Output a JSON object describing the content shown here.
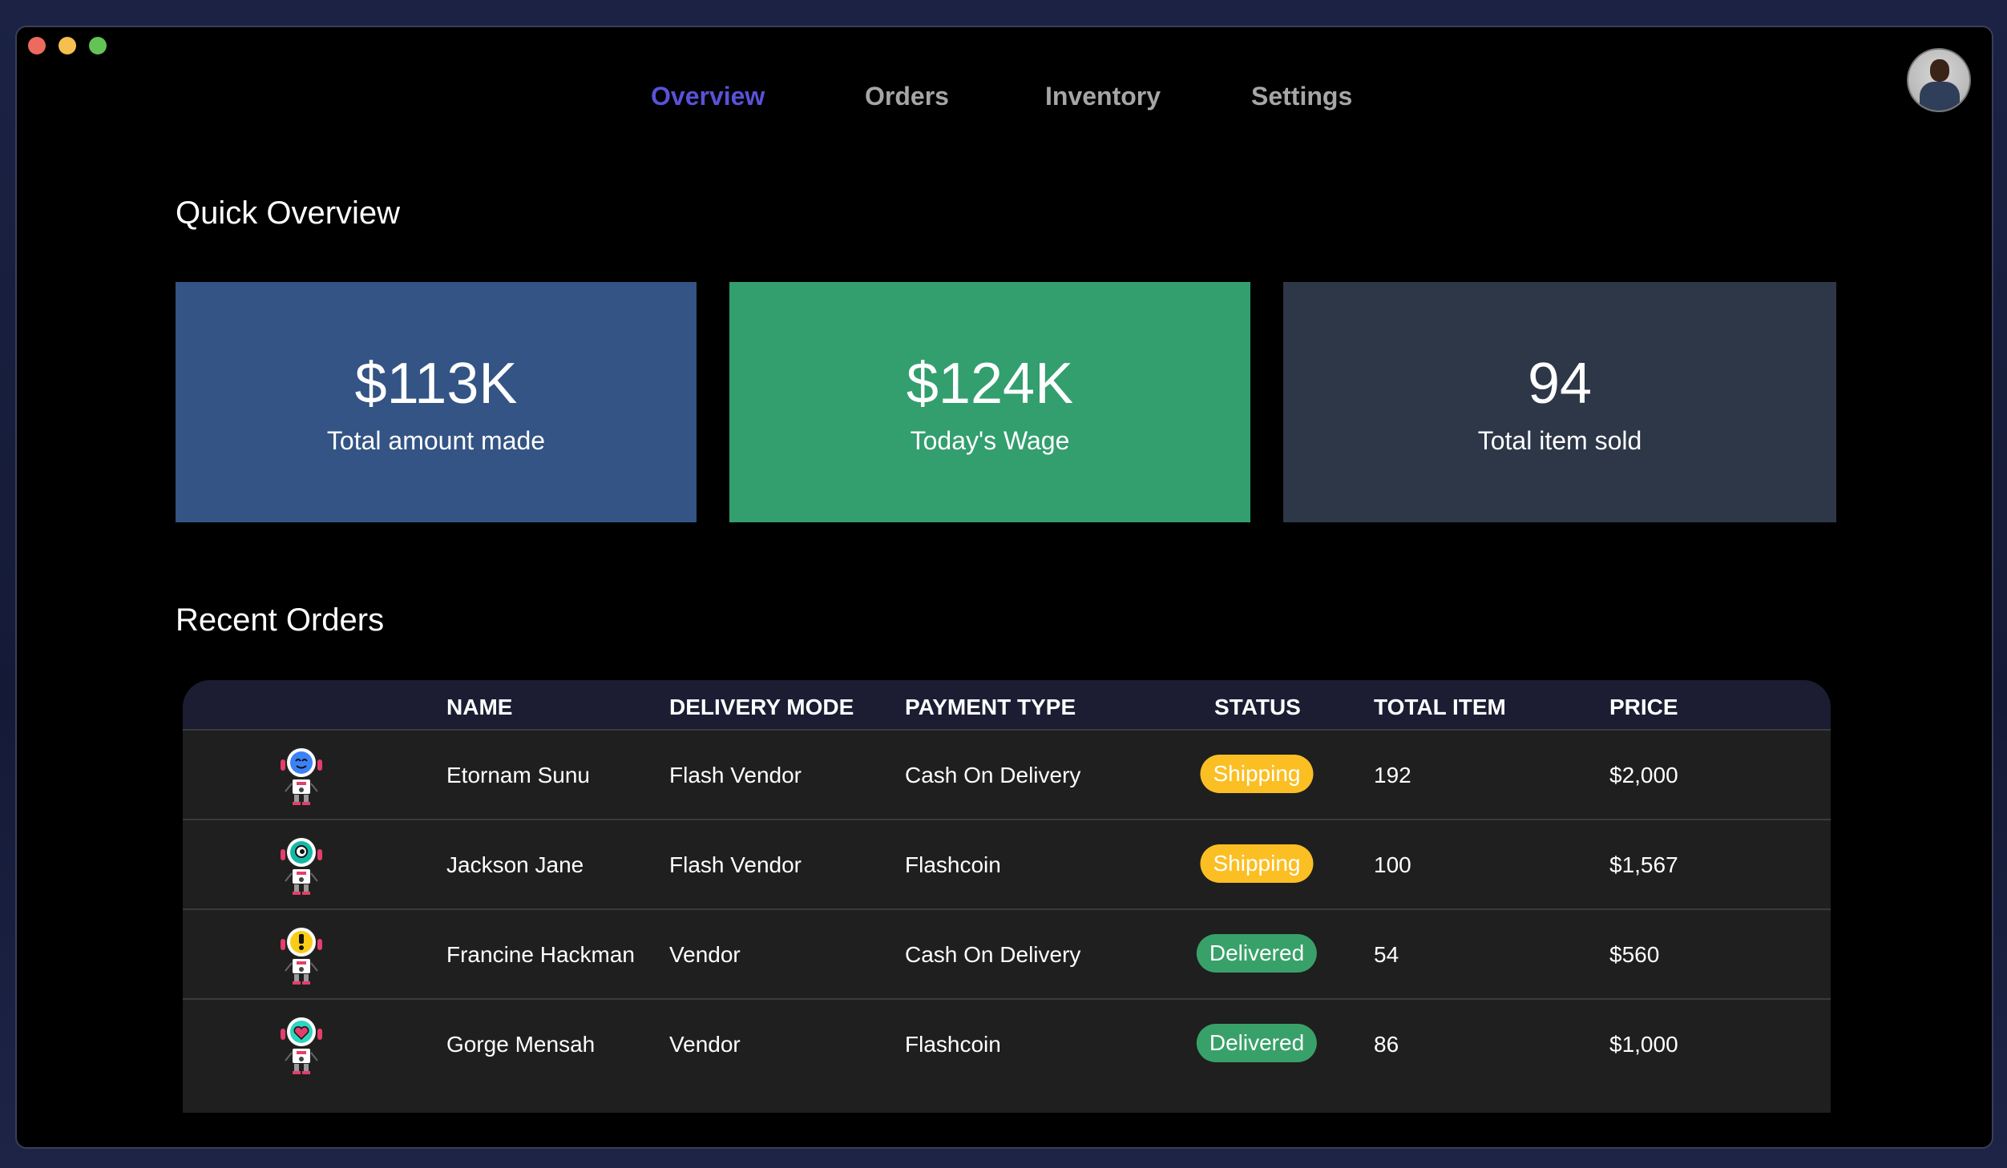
{
  "nav": {
    "items": [
      {
        "label": "Overview",
        "active": true
      },
      {
        "label": "Orders",
        "active": false
      },
      {
        "label": "Inventory",
        "active": false
      },
      {
        "label": "Settings",
        "active": false
      }
    ]
  },
  "overview": {
    "title": "Quick Overview",
    "cards": [
      {
        "value": "$113K",
        "label": "Total amount made",
        "color": "#335484"
      },
      {
        "value": "$124K",
        "label": "Today's Wage",
        "color": "#339e6e"
      },
      {
        "value": "94",
        "label": "Total item sold",
        "color": "#2d3748"
      }
    ]
  },
  "orders": {
    "title": "Recent Orders",
    "columns": [
      "NAME",
      "DELIVERY MODE",
      "PAYMENT TYPE",
      "STATUS",
      "TOTAL ITEM",
      "PRICE"
    ],
    "rows": [
      {
        "avatar_icon": "robot-blue-face-icon",
        "name": "Etornam Sunu",
        "delivery_mode": "Flash Vendor",
        "payment_type": "Cash On Delivery",
        "status": "Shipping",
        "total_item": "192",
        "price": "$2,000"
      },
      {
        "avatar_icon": "robot-teal-face-icon",
        "name": "Jackson Jane",
        "delivery_mode": "Flash Vendor",
        "payment_type": "Flashcoin",
        "status": "Shipping",
        "total_item": "100",
        "price": "$1,567"
      },
      {
        "avatar_icon": "robot-yellow-face-icon",
        "name": "Francine Hackman",
        "delivery_mode": "Vendor",
        "payment_type": "Cash On Delivery",
        "status": "Delivered",
        "total_item": "54",
        "price": "$560"
      },
      {
        "avatar_icon": "robot-heart-face-icon",
        "name": "Gorge Mensah",
        "delivery_mode": "Vendor",
        "payment_type": "Flashcoin",
        "status": "Delivered",
        "total_item": "86",
        "price": "$1,000"
      }
    ]
  },
  "colors": {
    "shipping": "#fbbf24",
    "delivered": "#38a169",
    "nav_active": "#5a52d8"
  }
}
